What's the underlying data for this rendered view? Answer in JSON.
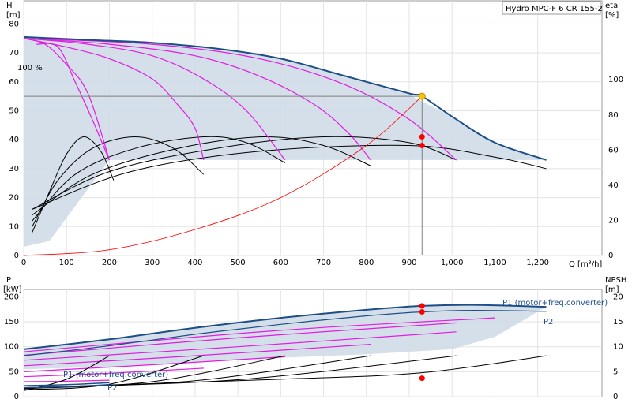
{
  "colors": {
    "envelope_fill": "#cfdbe8",
    "envelope_stroke": "#1d4f86",
    "speed_curve": "#e21be5",
    "efficiency_curve": "#000000",
    "system_curve": "#ff0000",
    "duty_line": "#808080",
    "duty_point": "#ff0000",
    "duty_point_top": "#f6c600"
  },
  "chart_data": [
    {
      "id": "qh",
      "type": "line",
      "title": "Hydro MPC-F 6 CR 155-2",
      "xlabel": "Q [m³/h]",
      "ylabel_left": "H",
      "ylabel_left_unit": "[m]",
      "ylabel_right": "eta",
      "ylabel_right_unit": "[%]",
      "xlim": [
        0,
        1350
      ],
      "ylim": [
        0,
        88
      ],
      "yright_lim": [
        0,
        145
      ],
      "grid": true,
      "x_ticks": [
        0,
        100,
        200,
        300,
        400,
        500,
        600,
        700,
        800,
        900,
        1000,
        1100,
        1200
      ],
      "x_tick_labels": [
        "0",
        "100",
        "200",
        "300",
        "400",
        "500",
        "600",
        "700",
        "800",
        "900",
        "1,000",
        "1,100",
        "1,200"
      ],
      "y_ticks": [
        0,
        10,
        20,
        30,
        40,
        50,
        60,
        70,
        80
      ],
      "yright_ticks": [
        0,
        20,
        40,
        60,
        80,
        100
      ],
      "annotation": "100 %",
      "envelope": [
        [
          0,
          75.5
        ],
        [
          150,
          74.5
        ],
        [
          300,
          73.5
        ],
        [
          450,
          71.5
        ],
        [
          600,
          68
        ],
        [
          750,
          62
        ],
        [
          900,
          55.5
        ],
        [
          1000,
          48
        ],
        [
          1100,
          39
        ],
        [
          1220,
          33
        ],
        [
          1100,
          33
        ],
        [
          200,
          33
        ],
        [
          60,
          5
        ],
        [
          0,
          3
        ]
      ],
      "max_speed_curve": [
        [
          0,
          75.5
        ],
        [
          150,
          74.5
        ],
        [
          300,
          73.5
        ],
        [
          450,
          71.5
        ],
        [
          600,
          68
        ],
        [
          750,
          62
        ],
        [
          900,
          56
        ],
        [
          930,
          55
        ],
        [
          1000,
          48
        ],
        [
          1100,
          39
        ],
        [
          1220,
          33
        ]
      ],
      "speed_curves": [
        [
          [
            0,
            75
          ],
          [
            50,
            73
          ],
          [
            100,
            66
          ],
          [
            150,
            56
          ],
          [
            200,
            33
          ]
        ],
        [
          [
            0,
            75
          ],
          [
            100,
            72
          ],
          [
            200,
            68
          ],
          [
            300,
            61
          ],
          [
            360,
            52
          ],
          [
            400,
            44
          ],
          [
            420,
            33
          ]
        ],
        [
          [
            0,
            75
          ],
          [
            150,
            73
          ],
          [
            300,
            69
          ],
          [
            420,
            61
          ],
          [
            520,
            50
          ],
          [
            610,
            33
          ]
        ],
        [
          [
            0,
            75
          ],
          [
            200,
            73
          ],
          [
            400,
            69
          ],
          [
            550,
            62
          ],
          [
            680,
            52
          ],
          [
            760,
            42
          ],
          [
            810,
            33
          ]
        ],
        [
          [
            0,
            75
          ],
          [
            300,
            73
          ],
          [
            550,
            68
          ],
          [
            750,
            59
          ],
          [
            900,
            47
          ],
          [
            1010,
            33
          ]
        ],
        [
          [
            30,
            73
          ],
          [
            80,
            72
          ],
          [
            120,
            60
          ],
          [
            160,
            47
          ],
          [
            200,
            33
          ]
        ]
      ],
      "efficiency_curves": [
        [
          [
            20,
            8
          ],
          [
            60,
            22
          ],
          [
            100,
            35
          ],
          [
            140,
            41
          ],
          [
            180,
            36
          ],
          [
            210,
            26
          ]
        ],
        [
          [
            20,
            10
          ],
          [
            80,
            26
          ],
          [
            160,
            37
          ],
          [
            260,
            41
          ],
          [
            350,
            37
          ],
          [
            420,
            28
          ]
        ],
        [
          [
            20,
            12
          ],
          [
            120,
            28
          ],
          [
            260,
            37
          ],
          [
            420,
            41
          ],
          [
            520,
            39
          ],
          [
            610,
            32
          ]
        ],
        [
          [
            20,
            14
          ],
          [
            160,
            28
          ],
          [
            360,
            37
          ],
          [
            560,
            41
          ],
          [
            700,
            38
          ],
          [
            810,
            31
          ]
        ],
        [
          [
            20,
            16
          ],
          [
            200,
            29
          ],
          [
            450,
            37
          ],
          [
            700,
            41
          ],
          [
            900,
            39
          ],
          [
            1010,
            33
          ]
        ],
        [
          [
            20,
            16
          ],
          [
            250,
            29
          ],
          [
            550,
            36
          ],
          [
            900,
            38
          ],
          [
            1100,
            34
          ],
          [
            1220,
            30
          ]
        ]
      ],
      "system_curve": [
        [
          0,
          0
        ],
        [
          200,
          2
        ],
        [
          400,
          9
        ],
        [
          600,
          20
        ],
        [
          800,
          38
        ],
        [
          930,
          55
        ]
      ],
      "duty_point": {
        "Q": 930,
        "H": 55
      },
      "duty_markers": [
        {
          "Q": 930,
          "H": 41
        },
        {
          "Q": 930,
          "H": 38
        }
      ]
    },
    {
      "id": "power",
      "type": "line",
      "xlabel": "",
      "ylabel_left": "P",
      "ylabel_left_unit": "[kW]",
      "ylabel_right": "NPSH",
      "ylabel_right_unit": "[m]",
      "xlim": [
        0,
        1350
      ],
      "ylim": [
        0,
        215
      ],
      "yright_lim": [
        0,
        21.5
      ],
      "grid": true,
      "y_ticks": [
        0,
        50,
        100,
        150,
        200
      ],
      "yright_ticks": [
        0,
        5,
        10,
        15,
        20
      ],
      "p1_label": "P1 (motor+freq.converter)",
      "p2_label": "P2",
      "p1_label_low": "P1 (motor+freq.converter)",
      "p2_label_low": "P2",
      "envelope": [
        [
          0,
          95
        ],
        [
          200,
          115
        ],
        [
          400,
          138
        ],
        [
          600,
          158
        ],
        [
          800,
          174
        ],
        [
          930,
          182
        ],
        [
          1050,
          184
        ],
        [
          1220,
          180
        ],
        [
          1100,
          120
        ],
        [
          1000,
          95
        ],
        [
          800,
          85
        ],
        [
          600,
          78
        ],
        [
          400,
          70
        ],
        [
          200,
          60
        ],
        [
          0,
          55
        ]
      ],
      "p1_max": [
        [
          0,
          95
        ],
        [
          200,
          115
        ],
        [
          400,
          138
        ],
        [
          600,
          158
        ],
        [
          800,
          174
        ],
        [
          930,
          182
        ],
        [
          1050,
          184
        ],
        [
          1220,
          180
        ]
      ],
      "p2_max": [
        [
          0,
          82
        ],
        [
          200,
          102
        ],
        [
          400,
          125
        ],
        [
          600,
          145
        ],
        [
          800,
          162
        ],
        [
          930,
          170
        ],
        [
          1050,
          173
        ],
        [
          1220,
          171
        ]
      ],
      "speed_power_curves": [
        [
          [
            0,
            30
          ],
          [
            100,
            31
          ],
          [
            200,
            33
          ]
        ],
        [
          [
            0,
            40
          ],
          [
            200,
            47
          ],
          [
            420,
            57
          ]
        ],
        [
          [
            0,
            50
          ],
          [
            300,
            64
          ],
          [
            610,
            80
          ]
        ],
        [
          [
            0,
            62
          ],
          [
            400,
            82
          ],
          [
            810,
            105
          ]
        ],
        [
          [
            0,
            73
          ],
          [
            500,
            100
          ],
          [
            1010,
            130
          ]
        ],
        [
          [
            0,
            83
          ],
          [
            500,
            118
          ],
          [
            1010,
            148
          ]
        ],
        [
          [
            0,
            90
          ],
          [
            600,
            133
          ],
          [
            1100,
            158
          ]
        ]
      ],
      "npsh_curves": [
        [
          [
            0,
            12
          ],
          [
            100,
            35
          ],
          [
            200,
            82
          ]
        ],
        [
          [
            0,
            14
          ],
          [
            200,
            25
          ],
          [
            420,
            82
          ]
        ],
        [
          [
            0,
            16
          ],
          [
            300,
            30
          ],
          [
            610,
            82
          ]
        ],
        [
          [
            0,
            17
          ],
          [
            400,
            32
          ],
          [
            810,
            82
          ]
        ],
        [
          [
            0,
            18
          ],
          [
            500,
            34
          ],
          [
            1010,
            82
          ]
        ],
        [
          [
            0,
            18
          ],
          [
            600,
            35
          ],
          [
            930,
            48
          ],
          [
            1220,
            82
          ]
        ]
      ],
      "low_p1": [
        [
          0,
          22
        ],
        [
          100,
          24
        ],
        [
          200,
          28
        ]
      ],
      "low_p2": [
        [
          0,
          18
        ],
        [
          100,
          20
        ],
        [
          200,
          24
        ]
      ],
      "duty_markers": [
        {
          "Q": 930,
          "P": 182
        },
        {
          "Q": 930,
          "P": 170
        },
        {
          "Q": 930,
          "P": 37
        }
      ]
    }
  ]
}
